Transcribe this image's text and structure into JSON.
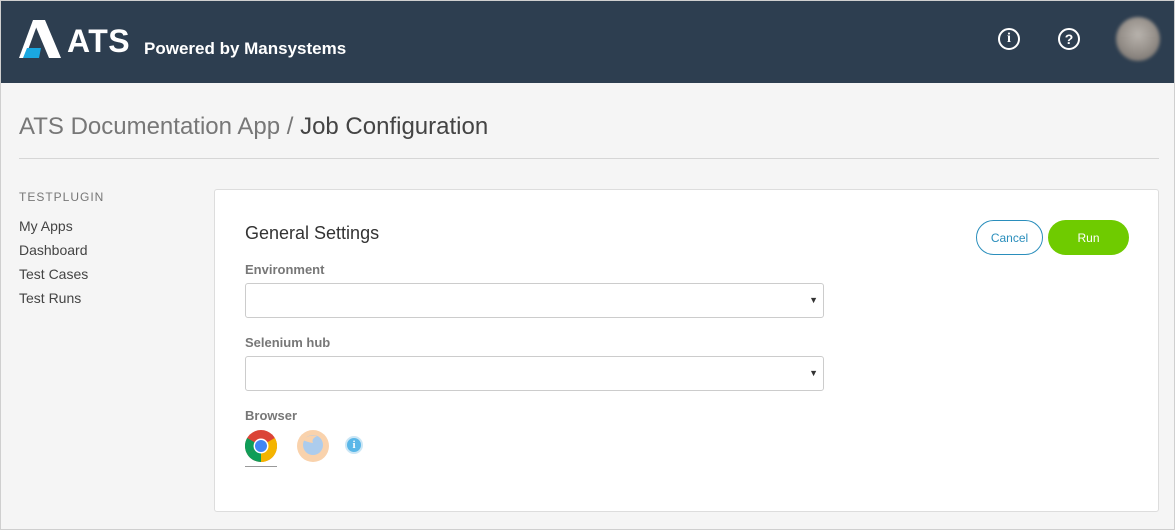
{
  "header": {
    "logo_text": "ATS",
    "logo_subtitle": "Powered by Mansystems",
    "info_icon_glyph": "i",
    "help_icon_glyph": "?"
  },
  "breadcrumb": {
    "app": "ATS Documentation App",
    "separator": "/",
    "current": "Job Configuration"
  },
  "sidebar": {
    "heading": "TESTPLUGIN",
    "items": [
      {
        "label": "My Apps"
      },
      {
        "label": "Dashboard"
      },
      {
        "label": "Test Cases"
      },
      {
        "label": "Test Runs"
      }
    ]
  },
  "card": {
    "title": "General Settings",
    "cancel_label": "Cancel",
    "run_label": "Run",
    "environment_label": "Environment",
    "environment_value": "",
    "selenium_hub_label": "Selenium hub",
    "selenium_hub_value": "",
    "browser_label": "Browser",
    "browsers": [
      {
        "icon": "chrome-icon",
        "selected": true
      },
      {
        "icon": "firefox-icon",
        "selected": false
      }
    ],
    "info_glyph": "i"
  },
  "colors": {
    "header_bg": "#2d3e50",
    "accent_blue": "#2a8ebc",
    "run_green": "#6fcb00",
    "logo_blue": "#1aa7e0"
  }
}
